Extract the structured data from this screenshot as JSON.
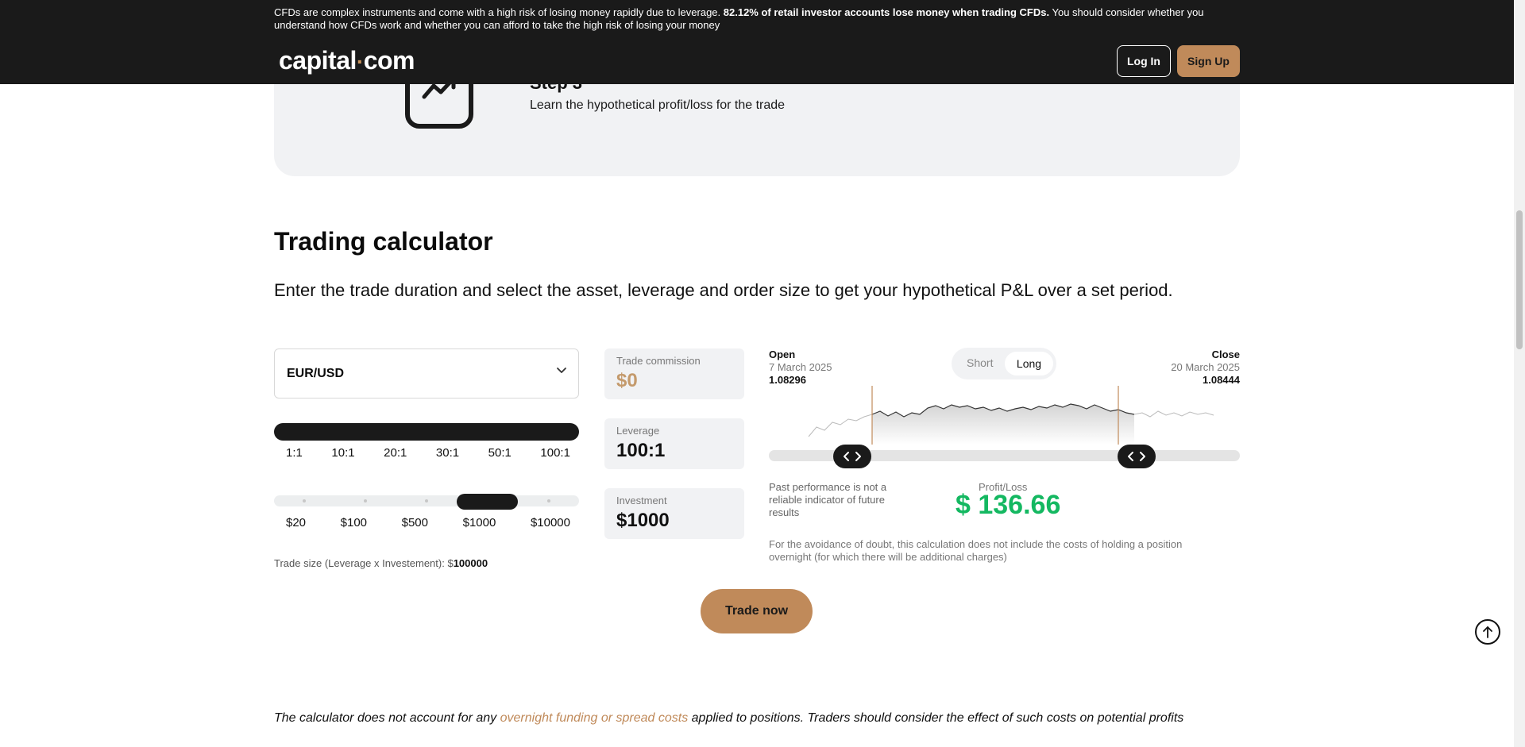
{
  "header": {
    "risk_warning_start": "CFDs are complex instruments and come with a high risk of losing money rapidly due to leverage. ",
    "risk_warning_bold": "82.12% of retail investor accounts lose money when trading CFDs.",
    "risk_warning_end": " You should consider whether you understand how CFDs work and whether you can afford to take the high risk of losing your money",
    "logo_left": "capital",
    "logo_dot": "·",
    "logo_right": "com",
    "login_label": "Log In",
    "signup_label": "Sign Up"
  },
  "step": {
    "title": "Step 3",
    "text": "Learn the hypothetical profit/loss for the trade"
  },
  "calculator": {
    "title": "Trading calculator",
    "lead": "Enter the trade duration and select the asset, leverage and order size to get your hypothetical P&L over a set period.",
    "asset": "EUR/USD",
    "leverage_options": [
      "1:1",
      "10:1",
      "20:1",
      "30:1",
      "50:1",
      "100:1"
    ],
    "investment_options": [
      "$20",
      "$100",
      "$500",
      "$1000",
      "$10000"
    ],
    "selected_investment": "$1000",
    "trade_size_label": "Trade size (Leverage x Investement): $",
    "trade_size_value": "100000",
    "commission_label": "Trade commission",
    "commission_value": "$0",
    "leverage_label": "Leverage",
    "leverage_value": "100:1",
    "investment_label": "Investment",
    "investment_value": "$1000",
    "open_title": "Open",
    "open_date": "7 March 2025",
    "open_price": "1.08296",
    "close_title": "Close",
    "close_date": "20 March 2025",
    "close_price": "1.08444",
    "toggle_short": "Short",
    "toggle_long": "Long",
    "toggle_selected": "Long",
    "past_performance": "Past performance is not a reliable indicator of future results",
    "pl_label": "Profit/Loss",
    "pl_value": "$ 136.66",
    "doubt_text": "For the avoidance of doubt, this calculation does not include the costs of holding a position overnight (for which there will be additional charges)",
    "trade_now_label": "Trade now",
    "colors": {
      "accent": "#c08a5a",
      "profit": "#14b861",
      "dark": "#1a1a1a"
    }
  },
  "disclaimer": {
    "before": "The calculator does not account for any ",
    "link": "overnight funding or spread costs",
    "after": " applied to positions. Traders should consider the effect of such costs on potential profits"
  },
  "icons": [
    "trend-up-icon",
    "chevron-down-icon",
    "arrows-left-right-icon",
    "arrow-up-icon"
  ]
}
